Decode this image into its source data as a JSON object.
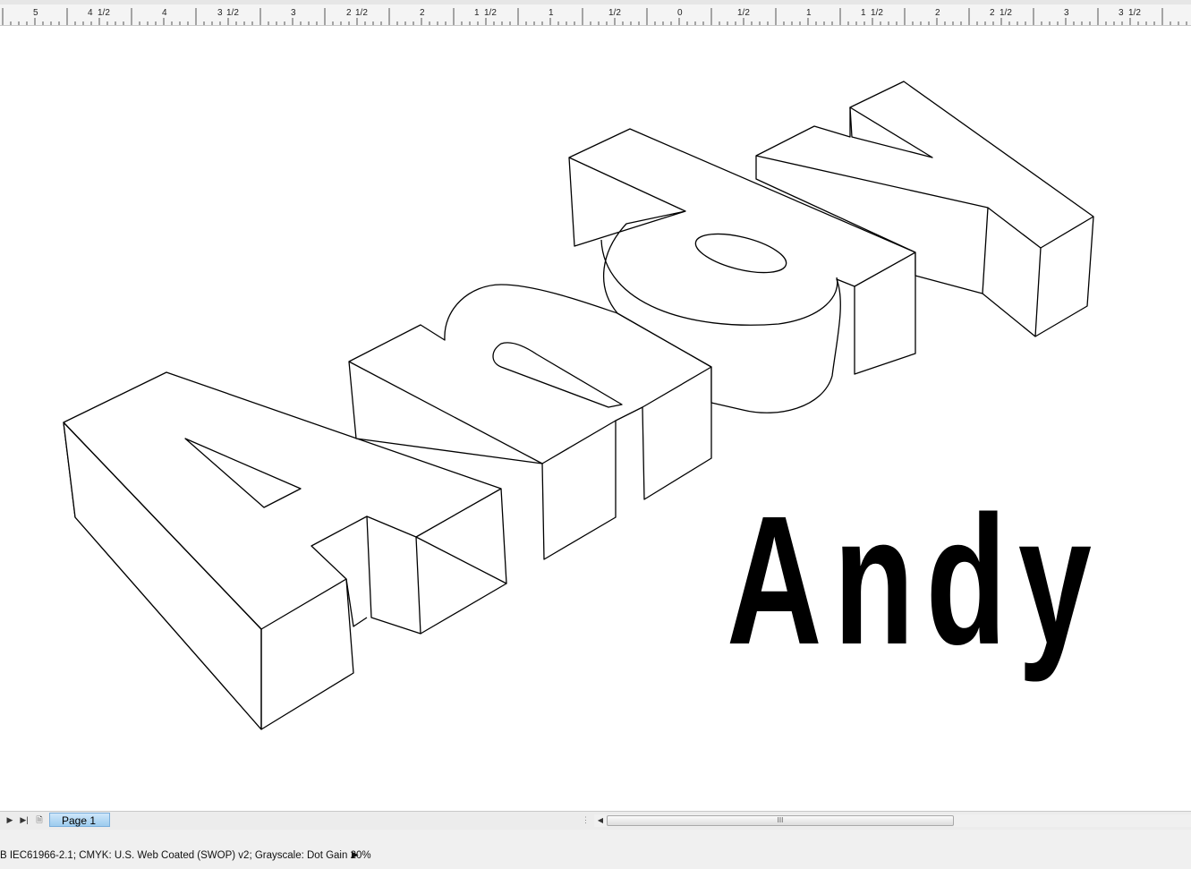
{
  "ruler": {
    "labels": [
      "5",
      "4",
      "1/2",
      "4",
      "3",
      "1/2",
      "3",
      "2",
      "1/2",
      "2",
      "1",
      "1/2",
      "1",
      "1/2",
      "0",
      "1/2",
      "1",
      "1",
      "1/2",
      "2",
      "2",
      "1/2",
      "3",
      "3",
      "1/2"
    ]
  },
  "canvas": {
    "outline_text": "Andy",
    "flat_text": "Andy",
    "stroke_color": "#000000",
    "fill_color": "#ffffff"
  },
  "page_tabs": {
    "active_tab_label": "Page 1",
    "nav_icons": [
      "next-page-icon",
      "last-page-icon",
      "add-page-icon"
    ],
    "scrollbar_grip": "III"
  },
  "status_bar": {
    "color_profile_text": "B IEC61966-2.1; CMYK: U.S. Web Coated (SWOP) v2; Grayscale: Dot Gain 20%",
    "expand_arrow": "▶"
  }
}
